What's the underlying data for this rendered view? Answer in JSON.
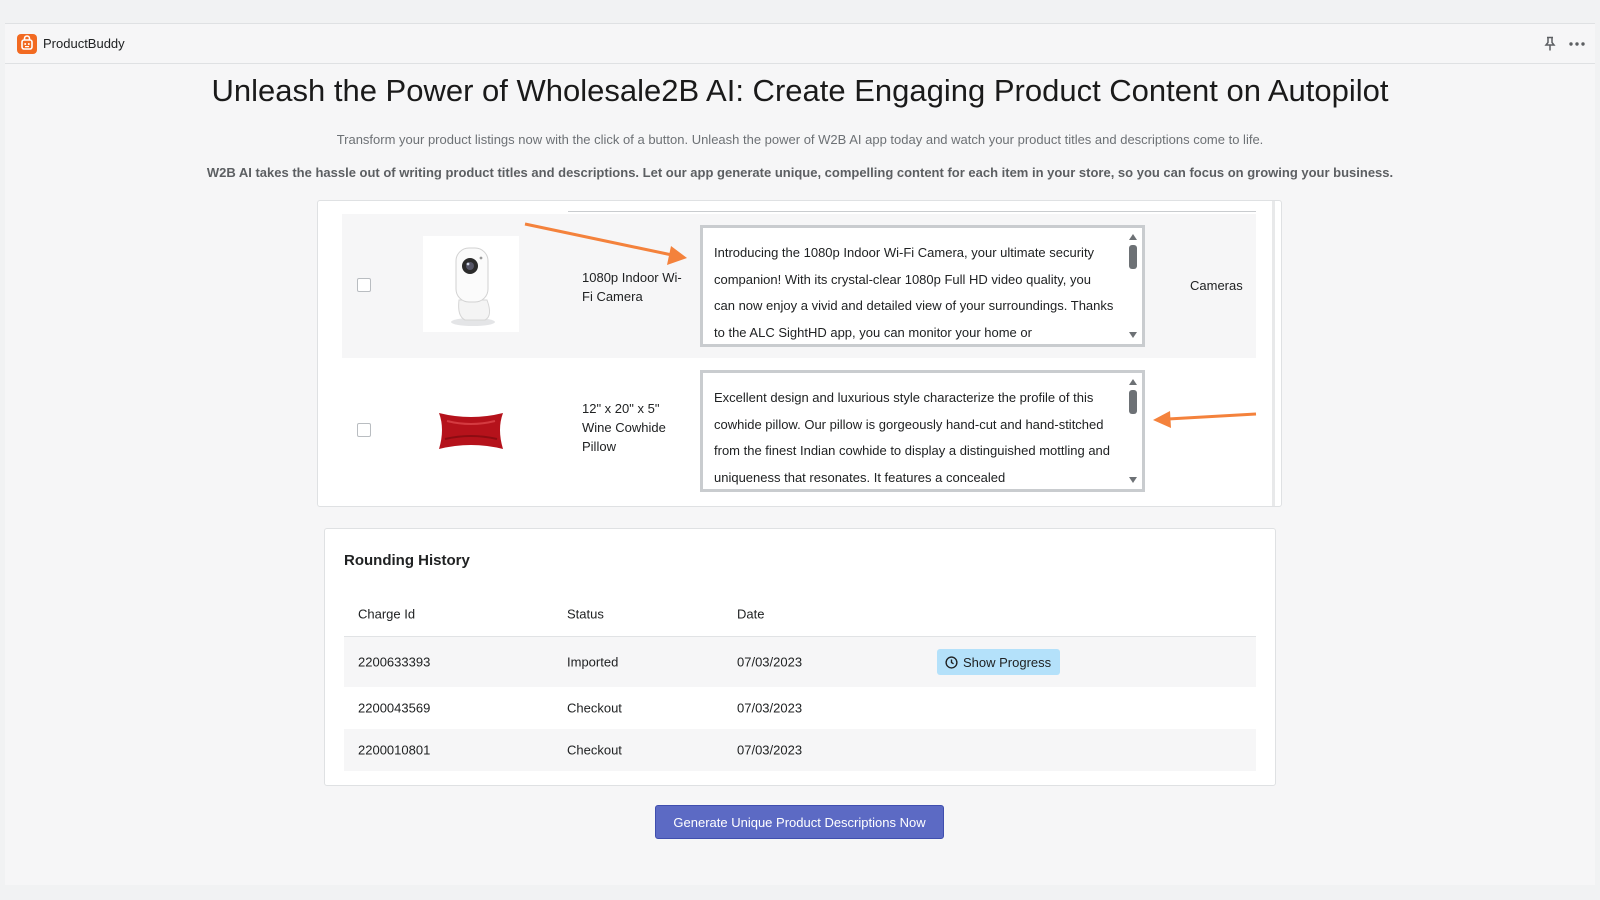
{
  "app": {
    "name": "ProductBuddy",
    "icons": {
      "logo": "robot-bag-icon",
      "pin": "pin-icon",
      "more": "more-horizontal-icon"
    },
    "brand_color": "#f26a21"
  },
  "hero": {
    "headline": "Unleash the Power of Wholesale2B AI: Create Engaging Product Content on Autopilot",
    "subtitle": "Transform your product listings now with the click of a button. Unleash the power of W2B AI app today and watch your product titles and descriptions come to life.",
    "tagline": "W2B AI takes the hassle out of writing product titles and descriptions. Let our app generate unique, compelling content for each item in your store, so you can focus on growing your business."
  },
  "products": [
    {
      "title": "1080p Indoor Wi-Fi Camera",
      "image": "indoor-camera-image",
      "description": "Introducing the 1080p Indoor Wi-Fi Camera, your ultimate security companion! With its crystal-clear 1080p Full HD video quality, you can now enjoy a vivid and detailed view of your surroundings. Thanks to the ALC SightHD app, you can monitor your home or",
      "category": "Cameras",
      "checked": false
    },
    {
      "title": "12\" x 20\" x 5\" Wine Cowhide Pillow",
      "image": "wine-cowhide-pillow-image",
      "description": "Excellent design and luxurious style characterize the profile of this cowhide pillow. Our pillow is gorgeously hand-cut and hand-stitched from the finest Indian cowhide to display a distinguished mottling and uniqueness that resonates. It features a concealed",
      "category": "",
      "checked": false
    }
  ],
  "history": {
    "title": "Rounding History",
    "columns": [
      "Charge Id",
      "Status",
      "Date"
    ],
    "rows": [
      {
        "charge_id": "2200633393",
        "status": "Imported",
        "date": "07/03/2023",
        "action": "Show Progress"
      },
      {
        "charge_id": "2200043569",
        "status": "Checkout",
        "date": "07/03/2023",
        "action": ""
      },
      {
        "charge_id": "2200010801",
        "status": "Checkout",
        "date": "07/03/2023",
        "action": ""
      }
    ],
    "action_icon": "clock-icon",
    "action_color": "#b4e1fa"
  },
  "generate_button": {
    "label": "Generate Unique Product Descriptions Now",
    "color": "#5c6ac4"
  },
  "annotation_arrow_color": "#f4823c"
}
